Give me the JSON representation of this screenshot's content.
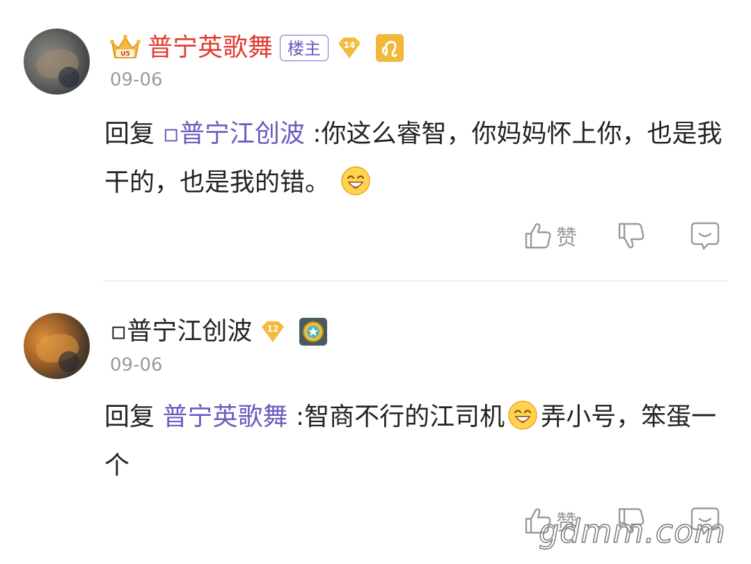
{
  "comments": [
    {
      "username": "普宁英歌舞",
      "op_badge": "楼主",
      "level": "14",
      "date": "09-06",
      "reply_prefix": "回复",
      "mention": "▫普宁江创波",
      "text_part1": ":你这么睿智，你妈妈怀上你，也是我干的，也是我的错。",
      "text_part2": "",
      "like_label": "赞",
      "icons": [
        "crown-icon",
        "level-diamond-icon",
        "leo-sign-icon",
        "grin-emoji-icon",
        "thumb-up-icon",
        "thumb-down-icon",
        "comment-reply-icon"
      ]
    },
    {
      "username": "▫普宁江创波",
      "level": "12",
      "date": "09-06",
      "reply_prefix": "回复",
      "mention": "普宁英歌舞",
      "text_part1": ":智商不行的江司机",
      "text_part2": "弄小号，笨蛋一个",
      "like_label": "赞",
      "icons": [
        "level-diamond-icon",
        "medal-star-icon",
        "grin-emoji-icon",
        "thumb-up-icon",
        "thumb-down-icon",
        "comment-reply-icon"
      ]
    }
  ],
  "watermark": "gdmm.com",
  "colors": {
    "vip_name": "#e23a30",
    "mention": "#6a5bbd",
    "date": "#9b9b9b",
    "badge_gold": "#f5b93b"
  }
}
